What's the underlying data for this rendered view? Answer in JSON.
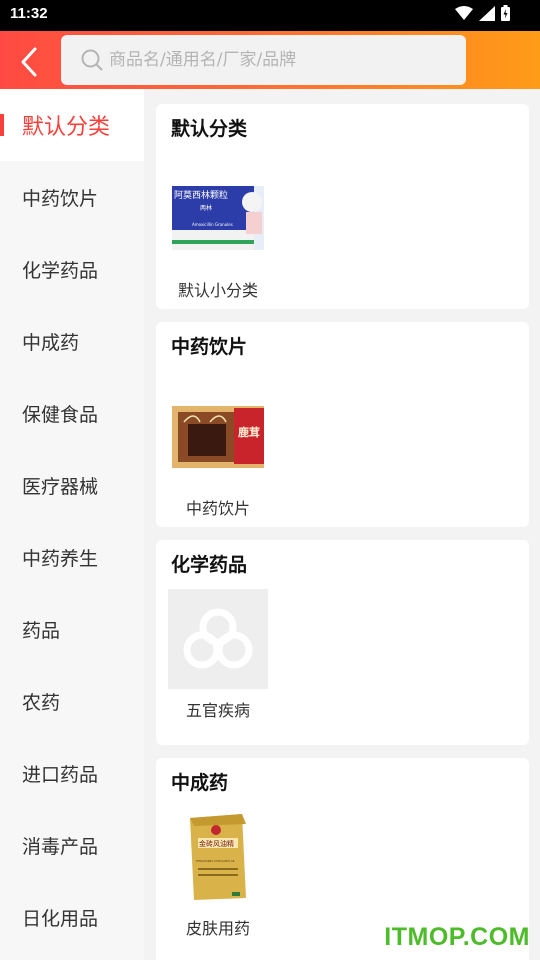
{
  "status_bar": {
    "time": "11:32"
  },
  "search": {
    "placeholder": "商品名/通用名/厂家/品牌"
  },
  "sidebar": {
    "items": [
      {
        "label": "默认分类"
      },
      {
        "label": "中药饮片"
      },
      {
        "label": "化学药品"
      },
      {
        "label": "中成药"
      },
      {
        "label": "保健食品"
      },
      {
        "label": "医疗器械"
      },
      {
        "label": "中药养生"
      },
      {
        "label": "药品"
      },
      {
        "label": "农药"
      },
      {
        "label": "进口药品"
      },
      {
        "label": "消毒产品"
      },
      {
        "label": "日化用品"
      }
    ]
  },
  "sections": [
    {
      "title": "默认分类",
      "product": {
        "name": "默认小分类",
        "box_text": "阿莫西林颗粒",
        "brand": "两林",
        "sub_text": "Amoxicillin Granules"
      }
    },
    {
      "title": "中药饮片",
      "product": {
        "name": "中药饮片",
        "box_text": "鹿茸"
      }
    },
    {
      "title": "化学药品",
      "product": {
        "name": "五官疾病"
      }
    },
    {
      "title": "中成药",
      "product": {
        "name": "皮肤用药",
        "box_text": "金砖风油精",
        "sub_text": "FENGYOUJING STIMULANTS OIL"
      }
    }
  ],
  "watermark": "ITMOP.COM",
  "colors": {
    "accent": "#f5413a",
    "header_start": "#ff4a43",
    "header_end": "#ff9c17",
    "watermark": "#4dbb2a"
  },
  "icons": {
    "back": "chevron-left-icon",
    "search": "search-icon"
  }
}
